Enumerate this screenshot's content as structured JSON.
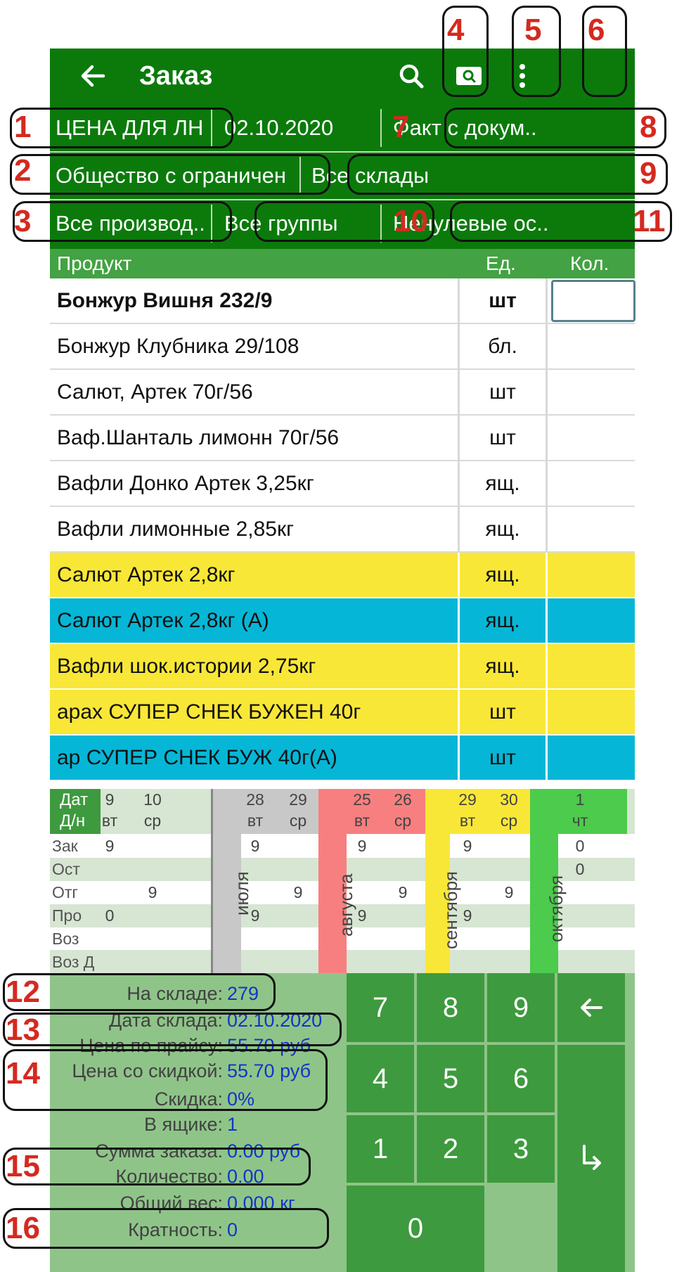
{
  "toolbar": {
    "title": "Заказ",
    "icons": [
      "back-arrow-icon",
      "search-icon",
      "barcode-search-icon",
      "more-vert-icon"
    ]
  },
  "filters": {
    "price_type": "ЦЕНА ДЛЯ ЛН..",
    "date": "02.10.2020",
    "doc_fact": "Факт с докум..",
    "organization": "Общество с ограничен..",
    "warehouses": "Все склады",
    "manufacturers": "Все производ..",
    "groups": "Все группы",
    "stock_filter": "Ненулевые ос.."
  },
  "columns": {
    "product": "Продукт",
    "unit": "Ед.",
    "qty": "Кол."
  },
  "products": [
    {
      "name": "Бонжур Вишня 232/9",
      "unit": "шт"
    },
    {
      "name": "Бонжур Клубника 29/108",
      "unit": "бл."
    },
    {
      "name": "Салют, Артек 70г/56",
      "unit": "шт"
    },
    {
      "name": "Ваф.Шанталь лимонн 70г/56",
      "unit": "шт"
    },
    {
      "name": "Вафли Донко Артек 3,25кг",
      "unit": "ящ."
    },
    {
      "name": "Вафли лимонные 2,85кг",
      "unit": "ящ."
    },
    {
      "name": "Салют Артек 2,8кг",
      "unit": "ящ."
    },
    {
      "name": "Салют Артек 2,8кг (А)",
      "unit": "ящ."
    },
    {
      "name": "Вафли шок.истории 2,75кг",
      "unit": "ящ."
    },
    {
      "name": "арах СУПЕР СНЕК БУЖЕН 40г",
      "unit": "шт"
    },
    {
      "name": "ар СУПЕР СНЕК БУЖ 40г(А)",
      "unit": "шт"
    }
  ],
  "row_colors": [
    "#ffffff",
    "#ffffff",
    "#ffffff",
    "#ffffff",
    "#ffffff",
    "#ffffff",
    "#f9e737",
    "#06b6d6",
    "#f9e737",
    "#f9e737",
    "#06b6d6"
  ],
  "calendar": {
    "head1": "Дат",
    "head2": "Д/н",
    "rows": [
      "Зак",
      "Ост",
      "Отг",
      "Про",
      "Воз",
      "Воз Д"
    ],
    "months": [
      "июля",
      "августа",
      "сентября",
      "октября"
    ],
    "month_colors": [
      "#c8c8c8",
      "#f87f7f",
      "#f9e737",
      "#4ccb4c"
    ],
    "dates": [
      {
        "day": "9",
        "dow": "вт",
        "zak": "9",
        "ost": "",
        "otg": "",
        "pro": "0"
      },
      {
        "day": "10",
        "dow": "ср",
        "zak": "",
        "ost": "",
        "otg": "9",
        "pro": ""
      },
      {
        "day": "28",
        "dow": "вт",
        "zak": "9",
        "ost": "",
        "otg": "",
        "pro": "9"
      },
      {
        "day": "29",
        "dow": "ср",
        "zak": "",
        "ost": "",
        "otg": "9",
        "pro": ""
      },
      {
        "day": "25",
        "dow": "вт",
        "zak": "9",
        "ost": "",
        "otg": "",
        "pro": "9"
      },
      {
        "day": "26",
        "dow": "ср",
        "zak": "",
        "ost": "",
        "otg": "9",
        "pro": ""
      },
      {
        "day": "29",
        "dow": "вт",
        "zak": "9",
        "ost": "",
        "otg": "",
        "pro": "9"
      },
      {
        "day": "30",
        "dow": "ср",
        "zak": "",
        "ost": "",
        "otg": "9",
        "pro": ""
      },
      {
        "day": "1",
        "dow": "чт",
        "zak": "0",
        "ost": "0",
        "otg": "",
        "pro": ""
      }
    ]
  },
  "info": [
    {
      "label": "На складе:",
      "value": "279"
    },
    {
      "label": "Дата склада:",
      "value": "02.10.2020"
    },
    {
      "label": "Цена по прайсу:",
      "value": "55.70 руб"
    },
    {
      "label": "Цена со скидкой:",
      "value": "55.70 руб"
    },
    {
      "label": "Скидка:",
      "value": "0%"
    },
    {
      "label": "В ящике:",
      "value": "1"
    },
    {
      "label": "Сумма заказа:",
      "value": "0.00 руб"
    },
    {
      "label": "Количество:",
      "value": "0.00"
    },
    {
      "label": "Общий вес:",
      "value": "0.000 кг"
    },
    {
      "label": "Кратность:",
      "value": "0"
    }
  ],
  "keypad": {
    "k7": "7",
    "k8": "8",
    "k9": "9",
    "backspace": "←",
    "k4": "4",
    "k5": "5",
    "k6": "6",
    "k1": "1",
    "k2": "2",
    "k3": "3",
    "enter": "↳",
    "k0": "0"
  },
  "annotations": [
    "1",
    "2",
    "3",
    "4",
    "5",
    "6",
    "7",
    "8",
    "9",
    "10",
    "11",
    "12",
    "13",
    "14",
    "15",
    "16"
  ],
  "colors": {
    "toolbar": "#0b7a0b",
    "header": "#43a243",
    "info_panel": "#8fc489",
    "key": "#3e9a3e",
    "value_text": "#1235c6",
    "annotation": "#d42a20"
  }
}
